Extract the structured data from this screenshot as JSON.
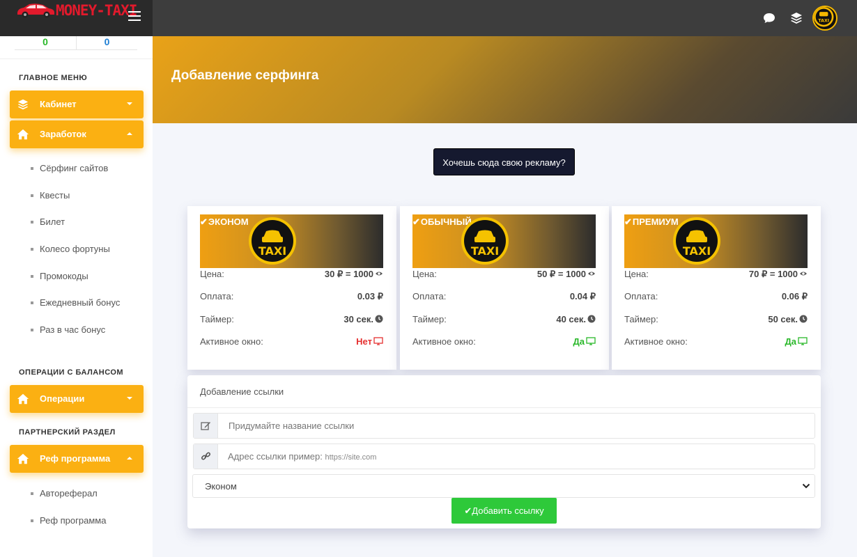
{
  "brand": {
    "logo_text": "MONEY-TAXI"
  },
  "sidebar": {
    "balances": [
      "0",
      "0"
    ],
    "main_menu_title": "ГЛАВНОЕ МЕНЮ",
    "cabinet": "Кабинет",
    "earnings": "Заработок",
    "earn_items": [
      "Сёрфинг сайтов",
      "Квесты",
      "Билет",
      "Колесо фортуны",
      "Промокоды",
      "Ежедневный бонус",
      "Раз в час бонус"
    ],
    "balance_ops_title": "ОПЕРАЦИИ С БАЛАНСОМ",
    "operations": "Операции",
    "partner_title": "ПАРТНЕРСКИЙ РАЗДЕЛ",
    "ref_program": "Реф программа",
    "ref_items": [
      "Автореферал",
      "Реф программа"
    ]
  },
  "page": {
    "title": "Добавление серфинга",
    "ad_button": "Хочешь сюда свою рекламу?"
  },
  "tariffs": [
    {
      "name": "ЭКОНОМ",
      "price": "30 ₽ = 1000",
      "payment": "0.03 ₽",
      "timer": "30 сек.",
      "active_window": "Нет"
    },
    {
      "name": "ОБЫЧНЫЙ",
      "price": "50 ₽ = 1000",
      "payment": "0.04 ₽",
      "timer": "40 сек.",
      "active_window": "Да"
    },
    {
      "name": "ПРЕМИУМ",
      "price": "70 ₽ = 1000",
      "payment": "0.06 ₽",
      "timer": "50 сек.",
      "active_window": "Да"
    }
  ],
  "labels": {
    "price": "Цена:",
    "payment": "Оплата:",
    "timer": "Таймер:",
    "active_window": "Активное окно:",
    "taxi": "TAXI"
  },
  "form": {
    "title": "Добавление ссылки",
    "name_placeholder": "Придумайте название ссылки",
    "url_placeholder_text": "Адрес ссылки пример: ",
    "url_placeholder_example": "https://site.com",
    "tariff_selected": "Эконом",
    "submit": "Добавить ссылку"
  },
  "colors": {
    "accent": "#fbb012",
    "topbar": "#3d3d3d",
    "success": "#2ec93a",
    "danger": "#e53030",
    "dark_button": "#15192f"
  },
  "icons": [
    "menu-icon",
    "chat-icon",
    "layers-icon",
    "home-icon",
    "eye-icon",
    "clock-icon",
    "monitor-icon",
    "edit-icon",
    "link-icon",
    "check-icon"
  ]
}
